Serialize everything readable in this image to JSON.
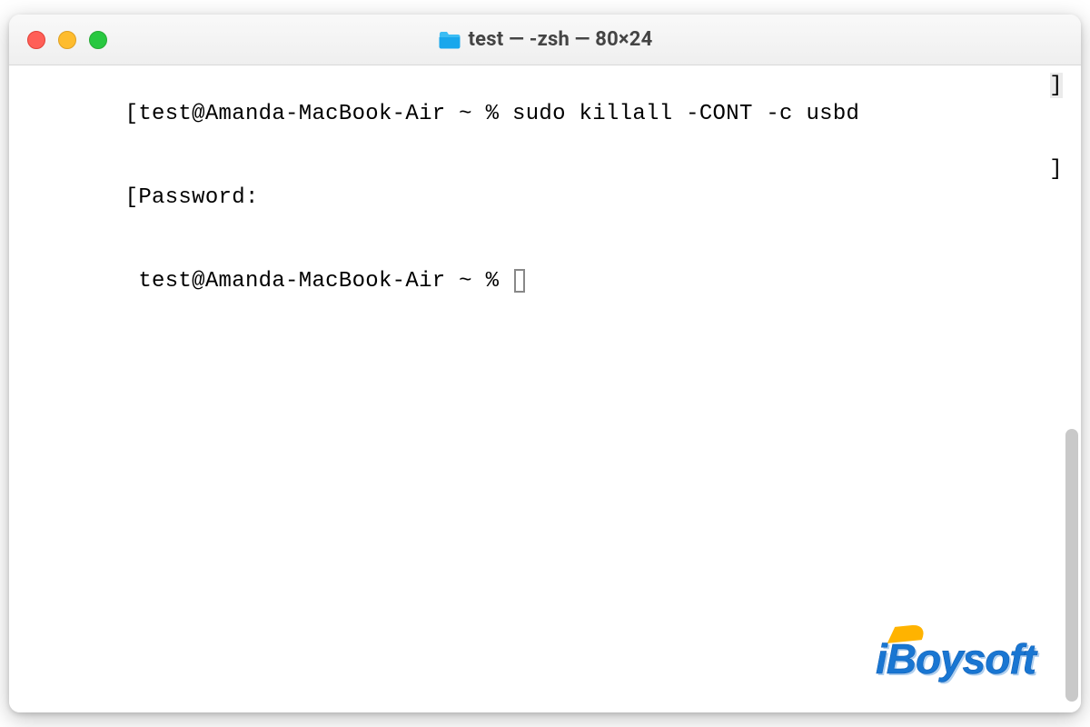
{
  "window": {
    "title": "test — -zsh — 80×24",
    "traffic_lights": {
      "close": "close",
      "minimize": "minimize",
      "maximize": "maximize"
    }
  },
  "terminal": {
    "lines": [
      {
        "left_bracket": "[",
        "prompt": "test@Amanda-MacBook-Air ~ % ",
        "command": "sudo killall -CONT -c usbd",
        "right_indicator": "]"
      },
      {
        "left_bracket": "[",
        "text": "Password:",
        "right_indicator": "]"
      },
      {
        "left_bracket": " ",
        "prompt": "test@Amanda-MacBook-Air ~ % ",
        "cursor": true
      }
    ]
  },
  "watermark": {
    "text": "iBoysoft"
  }
}
